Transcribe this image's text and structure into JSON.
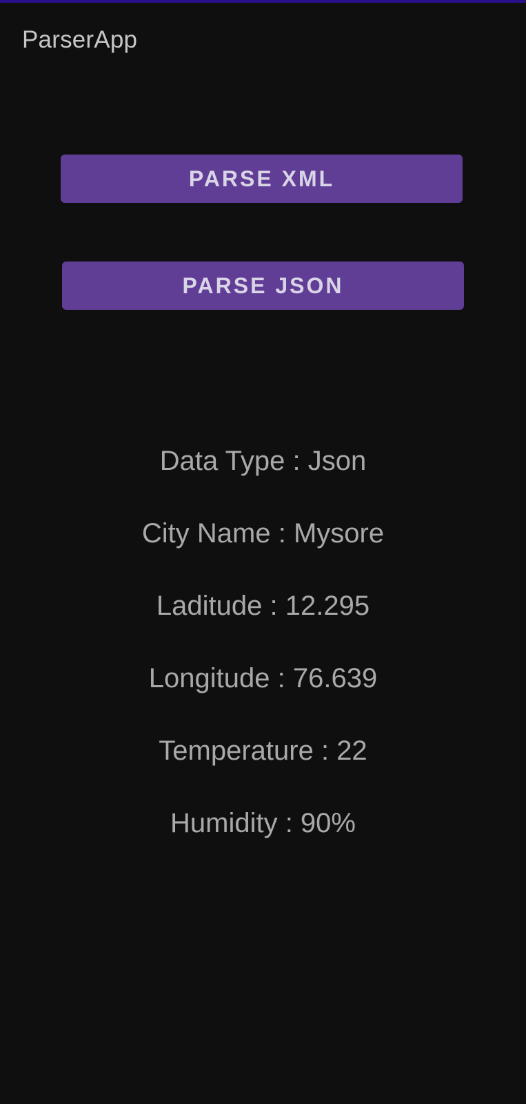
{
  "app": {
    "title": "ParserApp",
    "accent_color": "#2a0e8a",
    "button_color": "#613e96",
    "background_color": "#0f0f10"
  },
  "buttons": {
    "parse_xml": "PARSE XML",
    "parse_json": "PARSE JSON"
  },
  "info": {
    "data_type": "Data Type : Json",
    "city_name": "City Name : Mysore",
    "latitude": "Laditude : 12.295",
    "longitude": "Longitude : 76.639",
    "temperature": "Temperature : 22",
    "humidity": "Humidity : 90%"
  }
}
